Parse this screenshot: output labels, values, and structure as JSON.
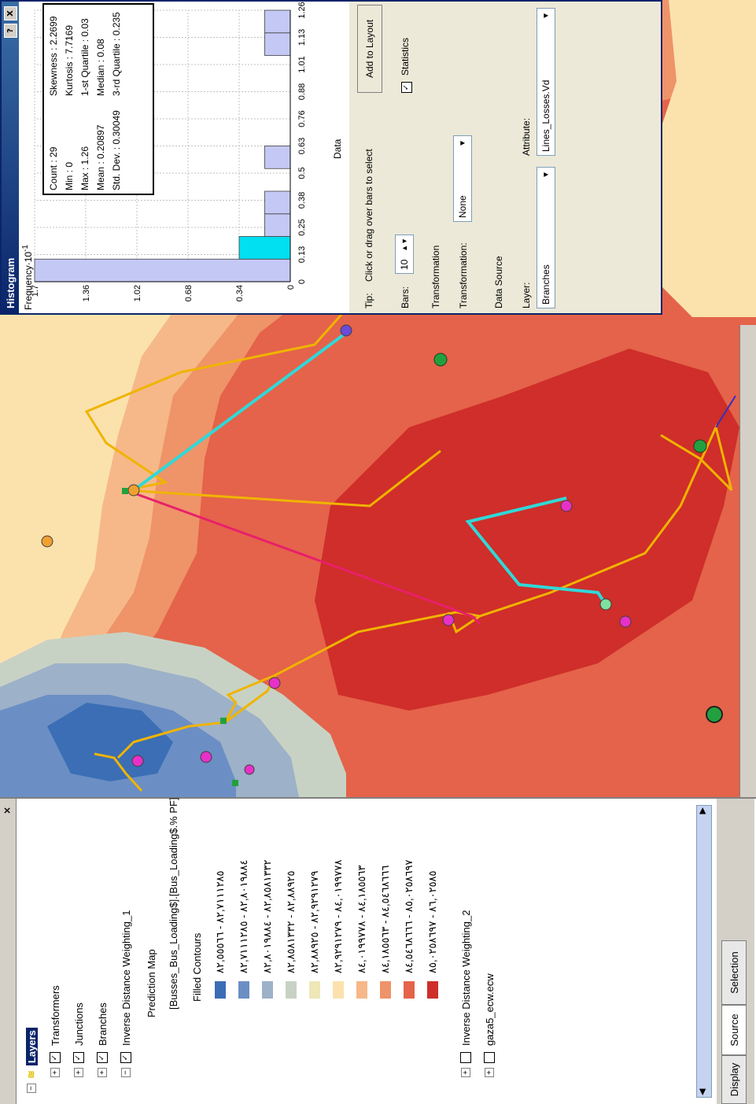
{
  "toc": {
    "close_label": "×",
    "root": "Layers",
    "layers": [
      {
        "label": "Transformers"
      },
      {
        "label": "Junctions"
      },
      {
        "label": "Branches"
      },
      {
        "label": "Inverse Distance Weighting_1"
      }
    ],
    "prediction_map": "Prediction Map",
    "field": "[Busses_Bus_Loading$].[Bus_Loading$.% PF]",
    "filled_contours": "Filled Contours",
    "legend": [
      {
        "range": "٨٢,٧١١١٢٨٥ - ٨٢,٥٥٥٦٦",
        "color": "#3b6eb5"
      },
      {
        "range": "٨٢,٨٠١٩٨٨٤ - ٨٢,٧١١١٢٨٥",
        "color": "#6b8fc4"
      },
      {
        "range": "٨٢,٨٥٨١٣٣٢ - ٨٢,٨٠١٩٨٨٤",
        "color": "#9db1c8"
      },
      {
        "range": "٨٢,٨٨٩٢٥ - ٨٢,٨٥٨١٣٣٢",
        "color": "#c8d2c4"
      },
      {
        "range": "٨٢,٩٢٩١٢٧٩ - ٨٢,٨٨٩٢٥",
        "color": "#eee7b7"
      },
      {
        "range": "٨٤,٠١٩٩٧٧٨ - ٨٢,٩٢٩١٢٧٩",
        "color": "#fbe2ad"
      },
      {
        "range": "٨٤,١٨٥٥٦٣ - ٨٤,٠١٩٩٧٧٨",
        "color": "#f6b888"
      },
      {
        "range": "٨٤,٥٤٦٨٦٦٦ - ٨٤,١٨٥٥٦٣",
        "color": "#ef9369"
      },
      {
        "range": "٨٥,٠٢٥٨٦٩٧ - ٨٤,٥٤٦٨٦٦٦",
        "color": "#e4634a"
      },
      {
        "range": "٨٦,٠٢٥٨٥ - ٨٥,٠٢٥٨٦٩٧",
        "color": "#cf2e2a"
      }
    ],
    "layer_idw2": "Inverse Distance Weighting_2",
    "layer_ecw": "gaza5_ecw.ecw",
    "tabs": [
      "Display",
      "Source",
      "Selection"
    ]
  },
  "histogram": {
    "title": "Histogram",
    "help": "?",
    "close": "X",
    "ylabel": "Frequency",
    "yexp": "·10",
    "yexp_sup": "-1",
    "xlabel": "Data",
    "stats": {
      "count": "Count  : 29",
      "min": "Min      : 0",
      "max": "Max      : 1.26",
      "mean": "Mean     : 0.20897",
      "std": "Std. Dev. : 0.30049",
      "skew": "Skewness   : 2.2699",
      "kurt": "Kurtosis     : 7.7169",
      "q1": "1-st Quartile : 0.03",
      "median": "Median       : 0.08",
      "q3": "3-rd Quartile : 0.235"
    },
    "tip_label": "Tip:",
    "tip_text": "Click or drag over bars to select",
    "add_to_layout": "Add to Layout",
    "bars_label": "Bars:",
    "bars_value": "10",
    "statistics_label": "Statistics",
    "statistics_check": "✓",
    "transformation_group": "Transformation",
    "transformation_label": "Transformation:",
    "transformation_value": "None",
    "datasource_group": "Data Source",
    "layer_label": "Layer:",
    "layer_value": "Branches",
    "attribute_label": "Attribute:",
    "attribute_value": "Lines_Losses.Vd",
    "dropdown_arrow": "▼"
  },
  "chart_data": {
    "type": "bar",
    "xlabel": "Data",
    "ylabel": "Frequency·10⁻¹",
    "x_ticks": [
      "0",
      "0.13",
      "0.25",
      "0.38",
      "0.5",
      "0.63",
      "0.76",
      "0.88",
      "1.01",
      "1.13",
      "1.26"
    ],
    "y_ticks": [
      "0",
      "0.34",
      "0.68",
      "1.02",
      "1.36",
      "1.7"
    ],
    "ylim": [
      0,
      1.7
    ],
    "values": [
      1.7,
      0.34,
      0.17,
      0.17,
      0.0,
      0.17,
      0.0,
      0.0,
      0.0,
      0.0,
      0.17,
      0.17
    ],
    "selected_bin": 1,
    "bar_color": "#c4c8f4",
    "selected_color": "#00e0f0"
  }
}
